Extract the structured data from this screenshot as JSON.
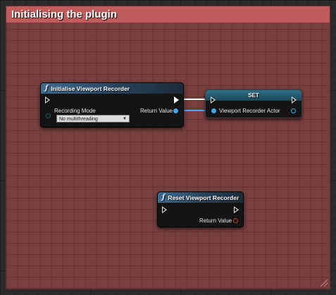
{
  "comment": {
    "title": "Initialising the plugin"
  },
  "init_node": {
    "title": "Initialise Viewport Recorder",
    "icon": "function-icon",
    "input_label": "Recording Mode",
    "dropdown_value": "No multithreading",
    "output_label": "Return Value"
  },
  "set_node": {
    "title": "SET",
    "input_label": "Viewport Recorder Actor"
  },
  "reset_node": {
    "title": "Reset Viewport Recorder",
    "icon": "function-icon",
    "output_label": "Return Value"
  },
  "colors": {
    "comment": "#c25b5b",
    "object_pin": "#3fa9f5",
    "struct_pin": "#c0392b",
    "exec_pin": "#ffffff",
    "enum_pin": "#0a6b5a"
  }
}
